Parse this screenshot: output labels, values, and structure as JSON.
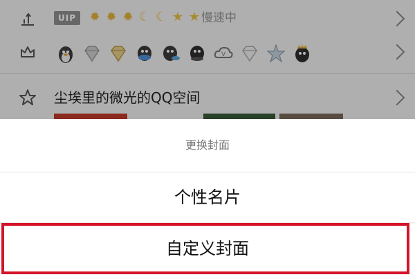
{
  "rows": {
    "vip": {
      "badge_text": "UIP",
      "level_icons": [
        "sun",
        "sun",
        "sun",
        "moon",
        "moon",
        "star",
        "star"
      ],
      "status_text": "慢速中"
    },
    "badges": {
      "items": [
        "penguin",
        "diamond-gray",
        "diamond-gold",
        "penguin-blue",
        "penguin-fish",
        "penguin-dark",
        "cloud-v",
        "diamond-white",
        "star-blue",
        "penguin-crown"
      ]
    },
    "space": {
      "title": "尘埃里的微光的QQ空间"
    }
  },
  "action_sheet": {
    "title": "更换封面",
    "options": [
      {
        "label": "个性名片"
      },
      {
        "label": "自定义封面"
      }
    ],
    "highlight_color": "#d5142a"
  },
  "colors": {
    "overlay": "rgba(0,0,0,0.28)",
    "accent_gold": "#e3b23c",
    "text_muted": "#999999"
  }
}
